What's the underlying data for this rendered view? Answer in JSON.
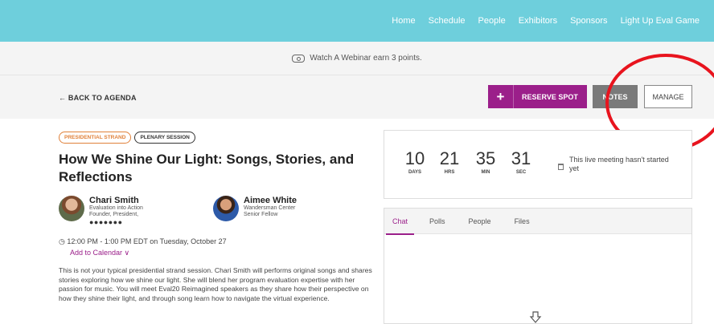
{
  "nav": {
    "items": [
      "Home",
      "Schedule",
      "People",
      "Exhibitors",
      "Sponsors",
      "Light Up Eval Game"
    ]
  },
  "banner": {
    "text": "Watch A Webinar earn 3 points."
  },
  "actions": {
    "back": "← BACK TO AGENDA",
    "reserve_plus": "+",
    "reserve": "RESERVE SPOT",
    "notes": "NOTES",
    "manage": "MANAGE"
  },
  "session": {
    "tags": [
      "PRESIDENTIAL STRAND",
      "PLENARY SESSION"
    ],
    "title": "How We Shine Our Light: Songs, Stories, and Reflections",
    "speakers": [
      {
        "name": "Chari Smith",
        "line1": "Evaluation into Action",
        "line2": "Founder, President,",
        "dots": "●●●●●●●"
      },
      {
        "name": "Aimee White",
        "line1": "Wandersman Center",
        "line2": "Senior Fellow"
      }
    ],
    "when": "12:00 PM - 1:00 PM EDT on Tuesday, October 27",
    "clock_glyph": "◷",
    "calendar_link": "Add to Calendar ∨",
    "description": "This is not your typical presidential strand session. Chari Smith will performs original songs and shares stories exploring how we shine our light. She will blend her program evaluation expertise with her passion for music. You will meet Eval20 Reimagined speakers as they share how their perspective on how they shine their light, and through song learn how to navigate the virtual experience."
  },
  "countdown": {
    "units": [
      {
        "value": "10",
        "label": "DAYS"
      },
      {
        "value": "21",
        "label": "HRS"
      },
      {
        "value": "35",
        "label": "MIN"
      },
      {
        "value": "31",
        "label": "SEC"
      }
    ],
    "message": "This live meeting hasn't started yet"
  },
  "panel": {
    "tabs": [
      "Chat",
      "Polls",
      "People",
      "Files"
    ],
    "active_tab": "Chat"
  },
  "colors": {
    "nav_bg": "#6ecfdc",
    "accent": "#9b1f8a",
    "tag_orange": "#e0813a",
    "highlight_circle": "#e8141e"
  }
}
